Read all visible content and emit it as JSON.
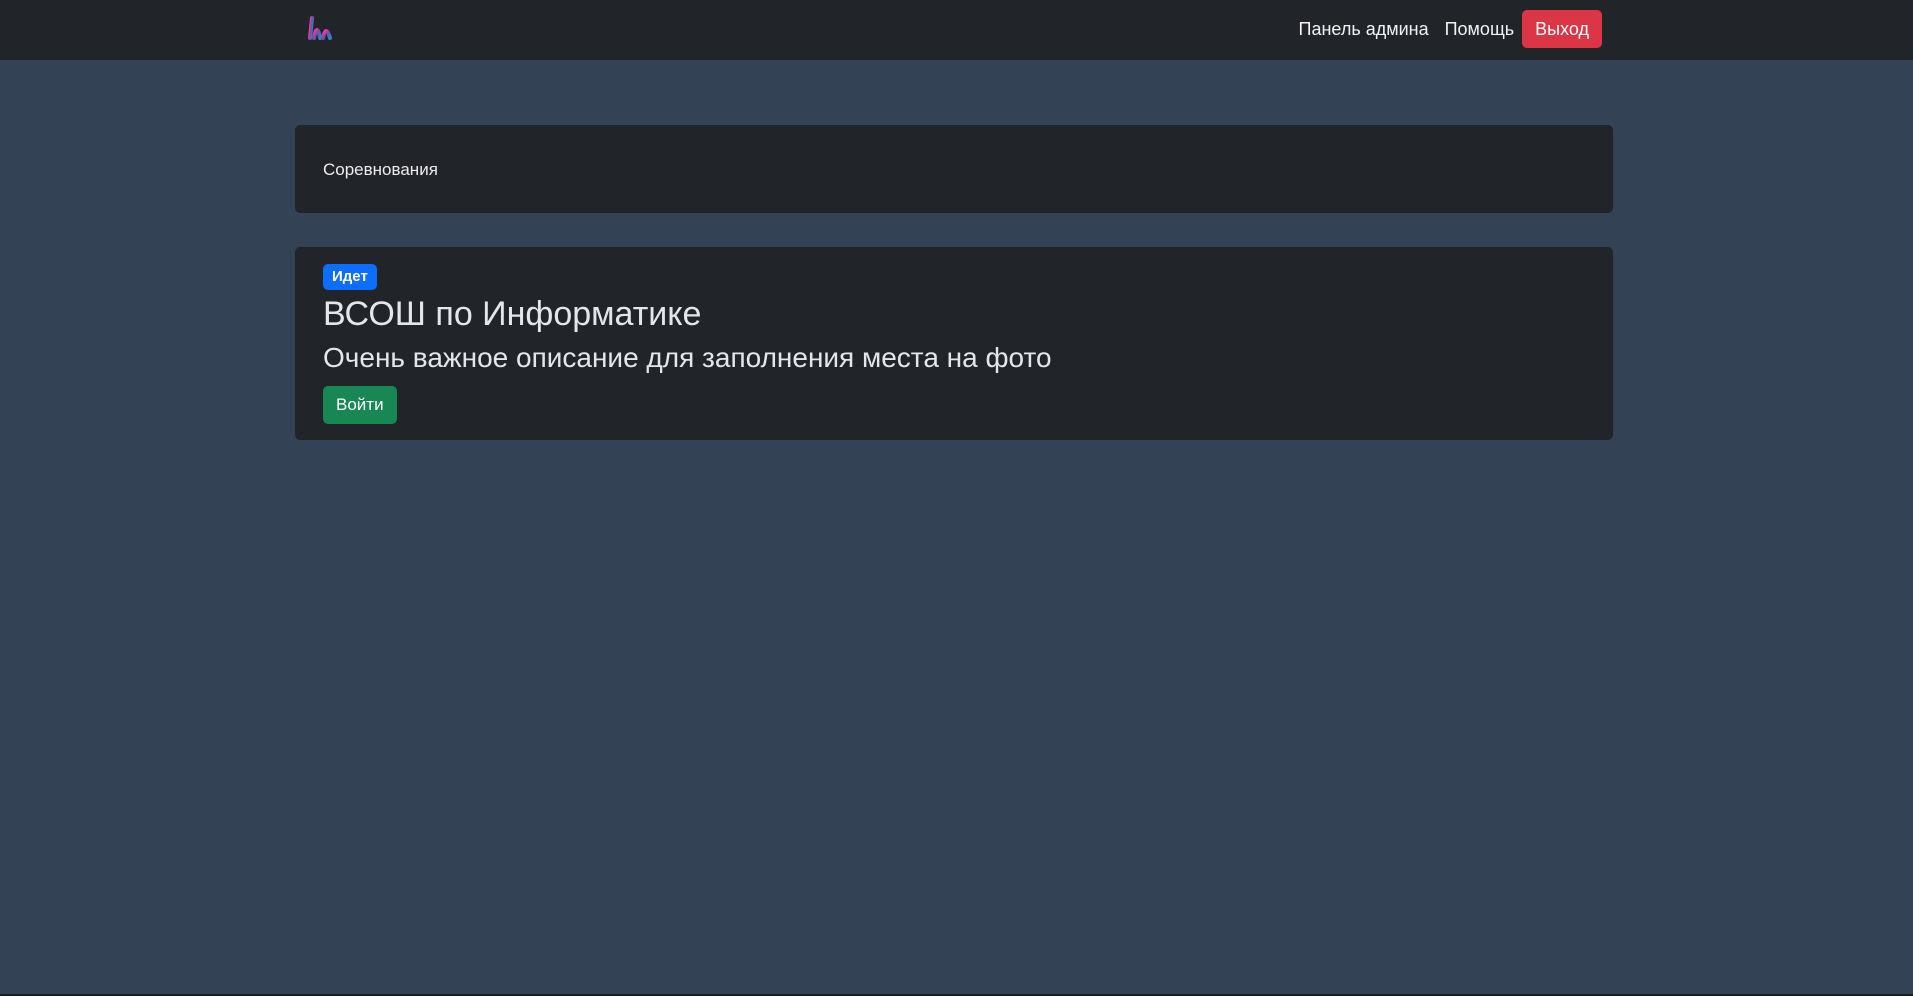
{
  "navbar": {
    "logo_icon": "gradient-logo-icon",
    "links": [
      {
        "label": "Панель админа"
      },
      {
        "label": "Помощь"
      }
    ],
    "logout_label": "Выход",
    "colors": {
      "background": "#212529",
      "logout": "#dc3545"
    }
  },
  "header_card": {
    "title": "Соревнования"
  },
  "contest": {
    "status": "Идет",
    "title": "ВСОШ по Информатике",
    "description": "Очень важное описание для заполнения места на фото",
    "enter_label": "Войти",
    "colors": {
      "status_badge": "#0d6efd",
      "enter_button": "#198754"
    }
  },
  "page": {
    "background": "#334355"
  }
}
